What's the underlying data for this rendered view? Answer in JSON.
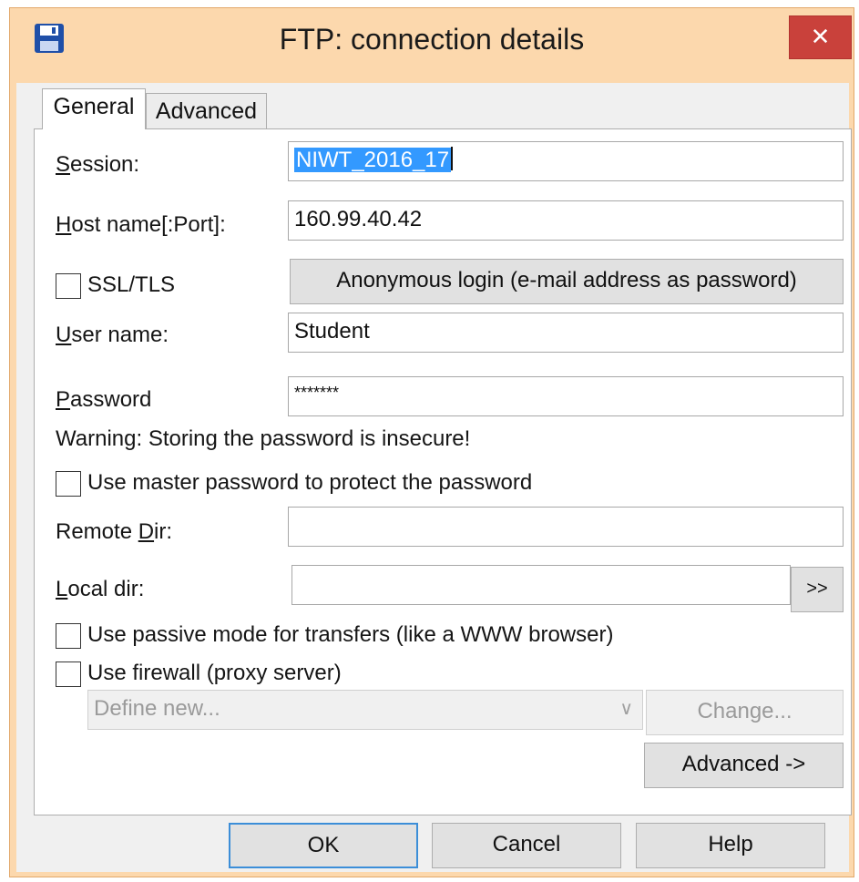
{
  "window": {
    "title": "FTP: connection details",
    "close_label": "✕"
  },
  "tabs": [
    {
      "label": "General",
      "selected": true
    },
    {
      "label": "Advanced",
      "selected": false
    }
  ],
  "form": {
    "session": {
      "label_key": "S",
      "label_rest": "ession:",
      "value": "NIWT_2016_17"
    },
    "host": {
      "label_key": "H",
      "label_rest": "ost name[:Port]:",
      "value": "160.99.40.42"
    },
    "ssl_label": "SSL/TLS",
    "anonymous_button": "Anonymous login (e-mail address as password)",
    "user": {
      "label_key": "U",
      "label_rest": "ser name:",
      "value": "Student"
    },
    "password": {
      "label_key": "P",
      "label_rest": "assword",
      "value": "*******"
    },
    "warning": "Warning: Storing the password is insecure!",
    "master_password_label": "Use master password to protect the password",
    "remote_dir": {
      "label_pre": "Remote ",
      "label_key": "D",
      "label_rest": "ir:",
      "value": ""
    },
    "local_dir": {
      "label_key": "L",
      "label_rest": "ocal dir:",
      "value": ""
    },
    "browse_button": ">>",
    "passive_label": "Use passive mode for transfers (like a WWW browser)",
    "firewall_label": "Use firewall (proxy server)",
    "proxy_select": {
      "value": "Define new...",
      "arrow": "∨"
    },
    "change_button": "Change...",
    "advanced_button": "Advanced ->"
  },
  "footer": {
    "ok": "OK",
    "cancel": "Cancel",
    "help": "Help"
  },
  "colors": {
    "titlebar": "#fcd8ad",
    "close": "#c9413b",
    "selection": "#3399ff"
  }
}
